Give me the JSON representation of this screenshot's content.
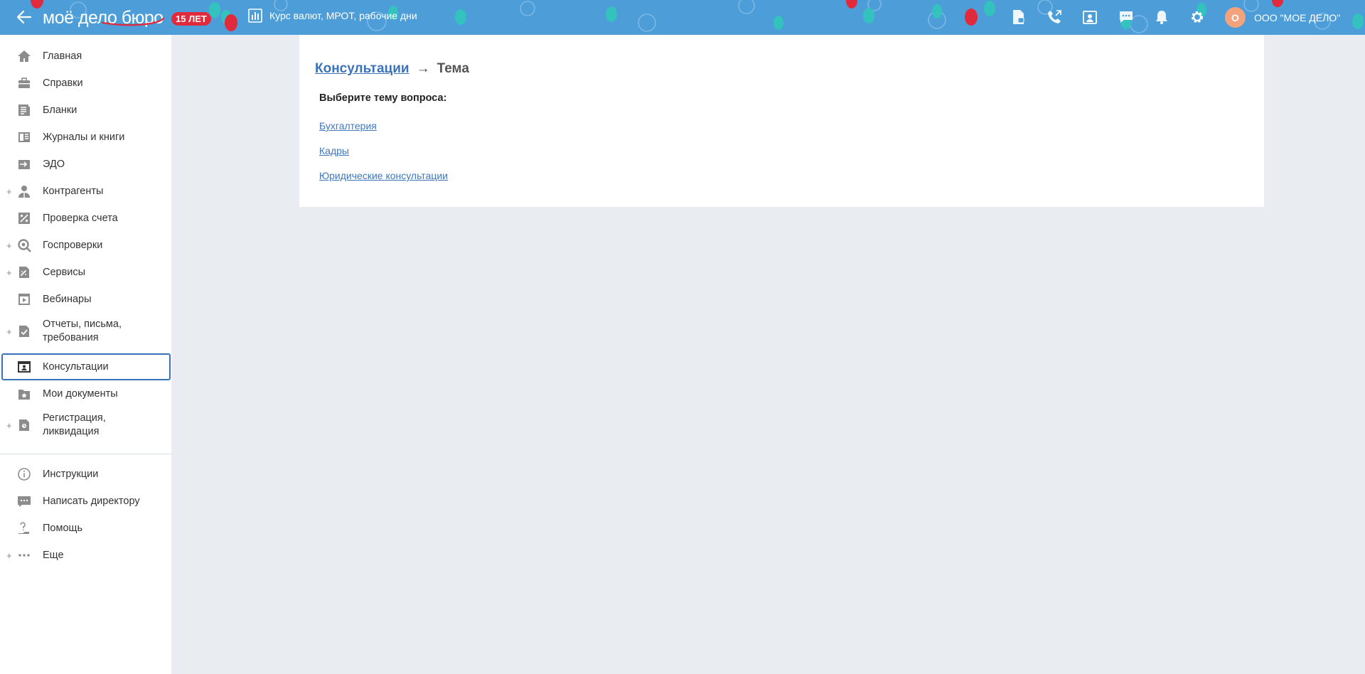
{
  "header": {
    "logo_text": "моё дело бюро",
    "badge": "15 ЛЕТ",
    "rates_label": "Курс валют, МРОТ, рабочие дни",
    "icons": [
      "document-lock-icon",
      "phone-icon",
      "calendar-person-icon",
      "chat-icon",
      "bell-icon",
      "gear-icon"
    ],
    "user_initial": "О",
    "org_name": "ООО \"МОЕ ДЕЛО\"",
    "colors": {
      "bar": "#4d9ed8",
      "badge": "#e22a3d",
      "avatar": "#f3a27b"
    }
  },
  "sidebar": {
    "items": [
      {
        "label": "Главная",
        "icon": "home-icon",
        "expandable": false
      },
      {
        "label": "Справки",
        "icon": "briefcase-icon",
        "expandable": false
      },
      {
        "label": "Бланки",
        "icon": "forms-icon",
        "expandable": false
      },
      {
        "label": "Журналы и книги",
        "icon": "journal-icon",
        "expandable": false
      },
      {
        "label": "ЭДО",
        "icon": "edo-icon",
        "expandable": false
      },
      {
        "label": "Контрагенты",
        "icon": "contractor-icon",
        "expandable": true
      },
      {
        "label": "Проверка счета",
        "icon": "account-check-icon",
        "expandable": false
      },
      {
        "label": "Госпроверки",
        "icon": "inspection-icon",
        "expandable": true
      },
      {
        "label": "Сервисы",
        "icon": "services-icon",
        "expandable": true
      },
      {
        "label": "Вебинары",
        "icon": "webinar-icon",
        "expandable": false
      },
      {
        "label": "Отчеты, письма, требования",
        "label_lines": [
          "Отчеты, письма,",
          "требования"
        ],
        "icon": "reports-icon",
        "expandable": true
      },
      {
        "label": "Консультации",
        "icon": "consultation-icon",
        "expandable": false,
        "active": true
      },
      {
        "label": "Мои документы",
        "icon": "my-docs-icon",
        "expandable": false
      },
      {
        "label": "Регистрация, ликвидация",
        "label_lines": [
          "Регистрация,",
          "ликвидация"
        ],
        "icon": "registration-icon",
        "expandable": true
      }
    ],
    "footer_items": [
      {
        "label": "Инструкции",
        "icon": "info-icon",
        "expandable": false
      },
      {
        "label": "Написать директору",
        "icon": "message-icon",
        "expandable": false
      },
      {
        "label": "Помощь",
        "icon": "help-icon",
        "expandable": false
      },
      {
        "label": "Еще",
        "icon": "more-icon",
        "expandable": true
      }
    ],
    "plus_symbol": "+"
  },
  "main": {
    "breadcrumb": {
      "parent": "Консультации",
      "arrow": "→",
      "current": "Тема"
    },
    "heading": "Выберите тему вопроса:",
    "topics": [
      "Бухгалтерия",
      "Кадры",
      "Юридические консультации"
    ],
    "link_color": "#3f78ba"
  }
}
